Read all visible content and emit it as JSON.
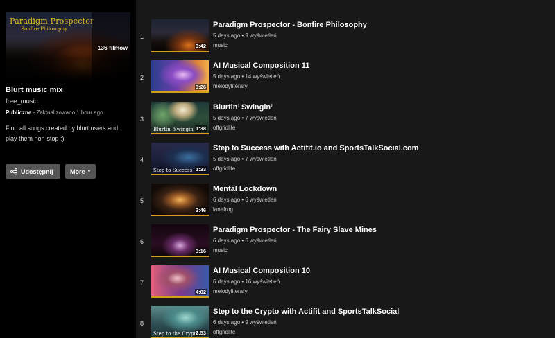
{
  "playlist": {
    "cover_title": "Paradigm Prospector",
    "cover_subtitle": "Bonfire Philosophy",
    "cover_note": "Paradigm Prospector · Bonfire Philosophy",
    "video_count": "136 filmów",
    "title": "Blurt music mix",
    "owner": "free_music",
    "visibility": "Publiczne",
    "updated": " - Zaktualizowano 1 hour ago",
    "description": "Find all songs created by blurt users and play them non-stop ;)"
  },
  "buttons": {
    "share_label": "Udostępnij",
    "more_label": "More"
  },
  "videos": [
    {
      "index": "1",
      "title": "Paradigm Prospector - Bonfire Philosophy",
      "meta": "5 days ago • 9 wyświetleń",
      "author": "music",
      "duration": "3:42",
      "thumb_text": ""
    },
    {
      "index": "2",
      "title": "AI Musical Composition 11",
      "meta": "5 days ago • 14 wyświetleń",
      "author": "melodyliterary",
      "duration": "3:26",
      "thumb_text": ""
    },
    {
      "index": "3",
      "title": "Blurtin’ Swingin’",
      "meta": "5 days ago • 7 wyświetleń",
      "author": "offgridlife",
      "duration": "1:38",
      "thumb_text": "Blurtin' Swingin'"
    },
    {
      "index": "4",
      "title": "Step to Success with Actifit.io and SportsTalkSocial.com",
      "meta": "5 days ago • 7 wyświetleń",
      "author": "offgridlife",
      "duration": "1:33",
      "thumb_text": "Step to Success"
    },
    {
      "index": "5",
      "title": "Mental Lockdown",
      "meta": "6 days ago • 6 wyświetleń",
      "author": "lanefrog",
      "duration": "3:46",
      "thumb_text": ""
    },
    {
      "index": "6",
      "title": "Paradigm Prospector - The Fairy Slave Mines",
      "meta": "6 days ago • 6 wyświetleń",
      "author": "music",
      "duration": "3:16",
      "thumb_text": ""
    },
    {
      "index": "7",
      "title": "AI Musical Composition 10",
      "meta": "6 days ago • 16 wyświetleń",
      "author": "melodyliterary",
      "duration": "4:02",
      "thumb_text": ""
    },
    {
      "index": "8",
      "title": "Step to the Crypto with Actifit and SportsTalkSocial",
      "meta": "6 days ago • 9 wyświetleń",
      "author": "offgridlife",
      "duration": "2:53",
      "thumb_text": "Step to the Crypto"
    }
  ],
  "colors": {
    "background": "#181818",
    "sidebar": "#000000",
    "button": "#555555",
    "progress_accent": "#d4a017",
    "cover_text": "#e9c21d"
  }
}
